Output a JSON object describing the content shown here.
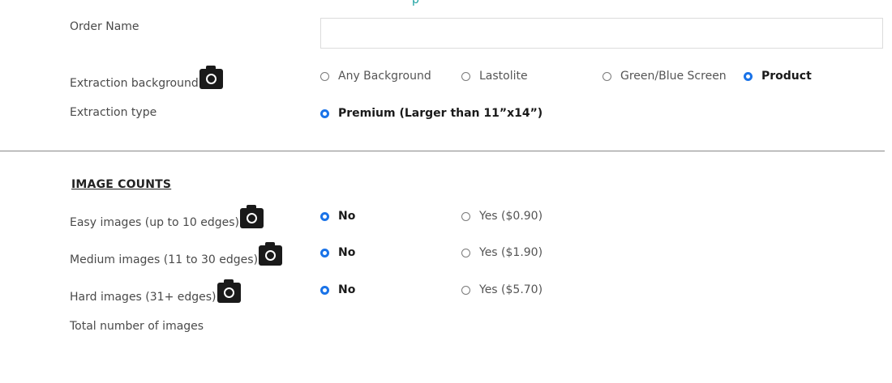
{
  "top_partial_text": "p",
  "order_name": {
    "label": "Order Name",
    "value": "",
    "placeholder": ""
  },
  "extraction_background": {
    "label": "Extraction background",
    "icon": "camera-icon",
    "options": [
      {
        "label": "Any Background",
        "selected": false
      },
      {
        "label": "Lastolite",
        "selected": false
      },
      {
        "label": "Green/Blue Screen",
        "selected": false
      },
      {
        "label": "Product",
        "selected": true
      }
    ]
  },
  "extraction_type": {
    "label": "Extraction type",
    "options": [
      {
        "label": "Premium (Larger than 11”x14”)",
        "selected": true
      }
    ]
  },
  "image_counts": {
    "title": "IMAGE COUNTS",
    "rows": [
      {
        "label": "Easy images (up to 10 edges)",
        "icon": "camera-icon",
        "no_label": "No",
        "yes_label": "Yes ($0.90)",
        "selected": "no"
      },
      {
        "label": "Medium images (11 to 30 edges)",
        "icon": "camera-icon",
        "no_label": "No",
        "yes_label": "Yes ($1.90)",
        "selected": "no"
      },
      {
        "label": "Hard images (31+ edges)",
        "icon": "camera-icon",
        "no_label": "No",
        "yes_label": "Yes ($5.70)",
        "selected": "no"
      }
    ],
    "total_label": "Total number of images"
  },
  "colors": {
    "radio_selected": "#1a73e8",
    "text": "#4a4a4a",
    "divider": "#888888"
  }
}
